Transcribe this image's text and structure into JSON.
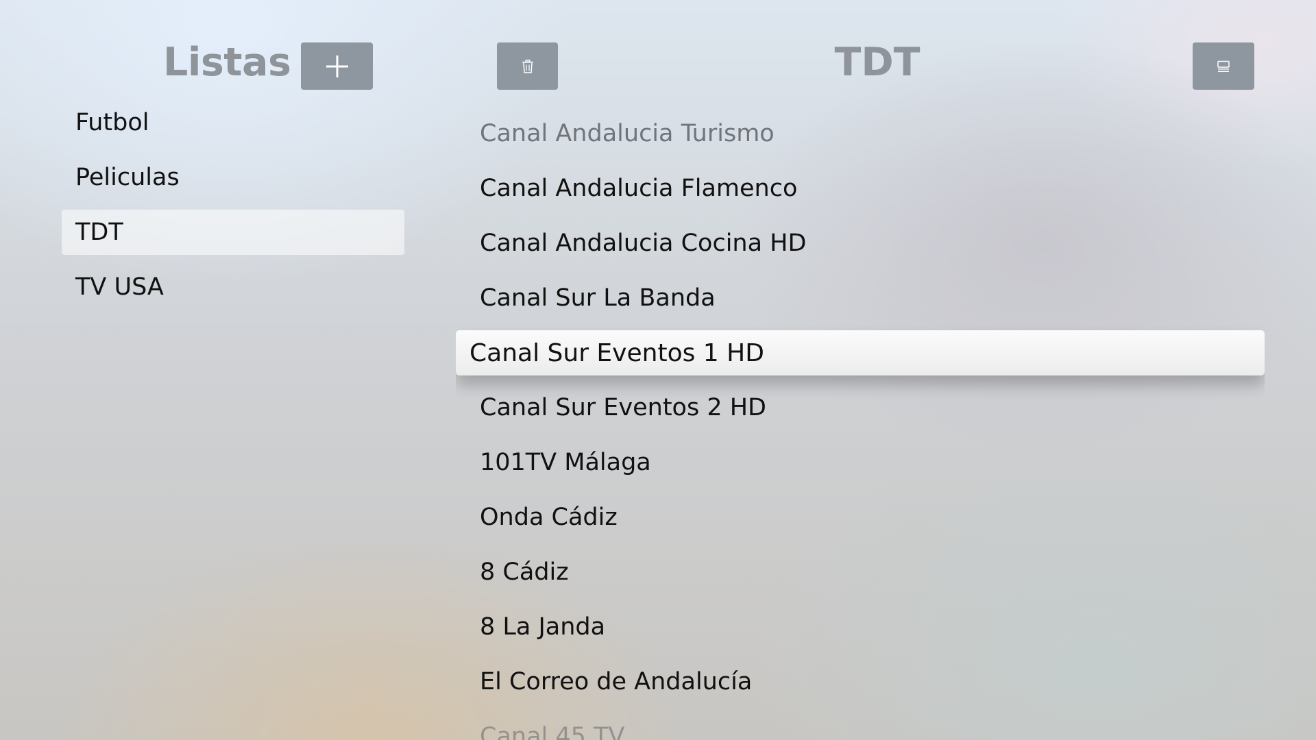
{
  "lists_panel": {
    "title": "Listas",
    "add_button": {
      "icon": "plus-icon"
    },
    "items": [
      {
        "label": "Futbol"
      },
      {
        "label": "Peliculas"
      },
      {
        "label": "TDT",
        "selected": true
      },
      {
        "label": "TV USA"
      }
    ]
  },
  "channels_panel": {
    "title": "TDT",
    "delete_button": {
      "icon": "trash-icon"
    },
    "edit_button": {
      "icon": "list-edit-icon"
    },
    "focused_index": 4,
    "items": [
      {
        "label": "Canal Andalucia Turismo"
      },
      {
        "label": "Canal Andalucia Flamenco"
      },
      {
        "label": "Canal Andalucia Cocina HD"
      },
      {
        "label": "Canal Sur La Banda"
      },
      {
        "label": "Canal Sur Eventos 1 HD"
      },
      {
        "label": "Canal Sur Eventos 2 HD"
      },
      {
        "label": "101TV Málaga"
      },
      {
        "label": "Onda Cádiz"
      },
      {
        "label": "8 Cádiz"
      },
      {
        "label": "8 La Janda"
      },
      {
        "label": "El Correo de Andalucía"
      },
      {
        "label": "Canal 45 TV"
      }
    ]
  },
  "colors": {
    "button_fill": "#8e969f",
    "title_gray": "#8f949b",
    "focus_fill": "#f5f5f5"
  }
}
